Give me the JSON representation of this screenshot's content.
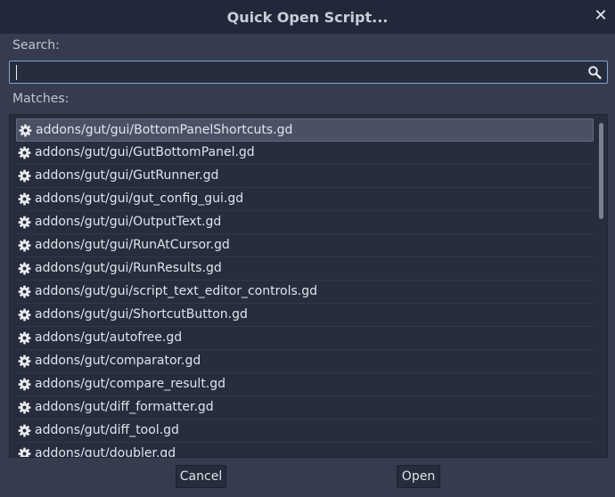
{
  "dialog": {
    "title": "Quick Open Script...",
    "close_glyph": "✕"
  },
  "search": {
    "label": "Search:",
    "value": "",
    "icon": "search-icon"
  },
  "matches": {
    "label": "Matches:",
    "item_icon": "gear-icon",
    "selected_index": 0,
    "items": [
      "addons/gut/gui/BottomPanelShortcuts.gd",
      "addons/gut/gui/GutBottomPanel.gd",
      "addons/gut/gui/GutRunner.gd",
      "addons/gut/gui/gut_config_gui.gd",
      "addons/gut/gui/OutputText.gd",
      "addons/gut/gui/RunAtCursor.gd",
      "addons/gut/gui/RunResults.gd",
      "addons/gut/gui/script_text_editor_controls.gd",
      "addons/gut/gui/ShortcutButton.gd",
      "addons/gut/autofree.gd",
      "addons/gut/comparator.gd",
      "addons/gut/compare_result.gd",
      "addons/gut/diff_formatter.gd",
      "addons/gut/diff_tool.gd",
      "addons/gut/doubler.gd"
    ]
  },
  "buttons": {
    "cancel": "Cancel",
    "open": "Open"
  },
  "colors": {
    "background": "#353c4e",
    "titlebar": "#21283a",
    "field": "#272d3d",
    "focus_border": "#7fa6d6",
    "selection": "#4a5164"
  }
}
